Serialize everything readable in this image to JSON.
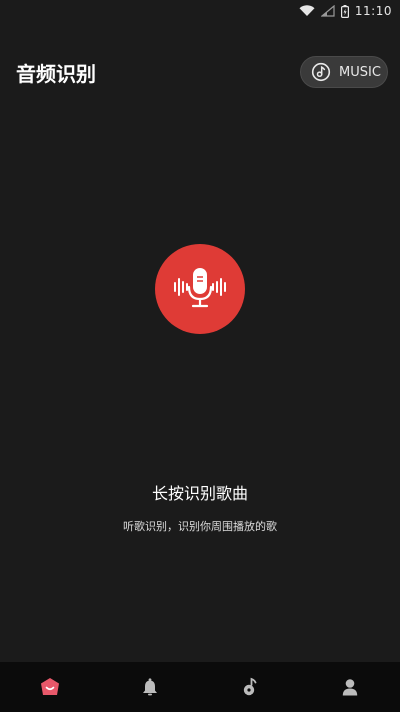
{
  "status_bar": {
    "time": "11:10"
  },
  "header": {
    "title": "音频识别",
    "music_button_label": "MUSIC"
  },
  "main": {
    "primary_hint": "长按识别歌曲",
    "secondary_hint": "听歌识别，识别你周围播放的歌"
  },
  "bottom_nav": {
    "items": [
      {
        "icon": "home-icon",
        "active": true
      },
      {
        "icon": "bell-icon",
        "active": false
      },
      {
        "icon": "music-note-icon",
        "active": false
      },
      {
        "icon": "user-icon",
        "active": false
      }
    ]
  },
  "colors": {
    "background": "#1b1b1b",
    "accent": "#df3b36",
    "nav_background": "#0b0b0b",
    "active_icon": "#e8586a",
    "inactive_icon": "#bcbcbc"
  }
}
